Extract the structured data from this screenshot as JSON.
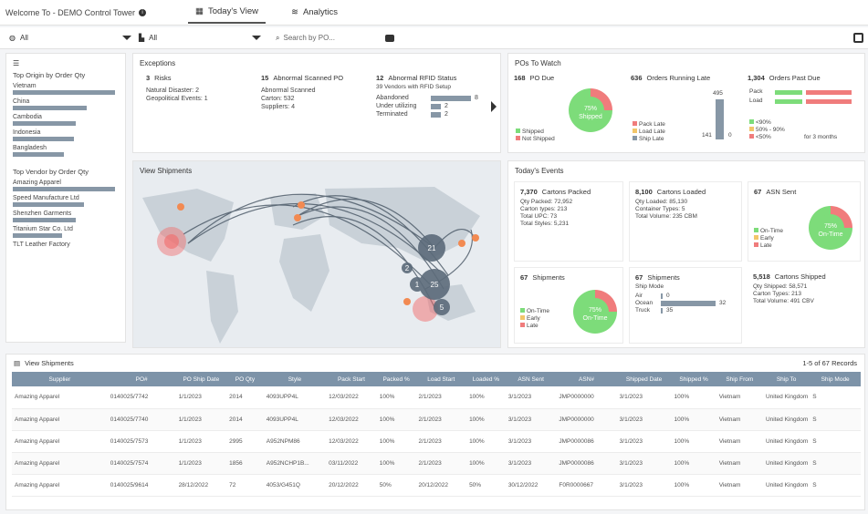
{
  "topbar": {
    "title": "Welcome To - DEMO Control Tower",
    "tab_today": "Today's View",
    "tab_analytics": "Analytics"
  },
  "filters": {
    "filter1": "All",
    "filter2": "All",
    "search_placeholder": "Search by PO..."
  },
  "left": {
    "origin_title": "Top Origin by Order Qty",
    "origins": [
      {
        "name": "Vietnam",
        "value": 100
      },
      {
        "name": "China",
        "value": 72
      },
      {
        "name": "Cambodia",
        "value": 62
      },
      {
        "name": "Indonesia",
        "value": 60
      },
      {
        "name": "Bangladesh",
        "value": 50
      }
    ],
    "vendor_title": "Top Vendor by Order Qty",
    "vendors": [
      {
        "name": "Amazing Apparel",
        "value": 100
      },
      {
        "name": "Speed Manufacture Ltd",
        "value": 70
      },
      {
        "name": "Shenzhen Garments",
        "value": 62
      },
      {
        "name": "Titanium Star Co. Ltd",
        "value": 48
      },
      {
        "name": "TLT Leather Factory",
        "value": 0
      }
    ]
  },
  "exceptions": {
    "title": "Exceptions",
    "risks": {
      "count": "3",
      "label": "Risks",
      "lines": [
        "Natural Disaster: 2",
        "Geopolitical Events: 1"
      ]
    },
    "scanned": {
      "count": "15",
      "label": "Abnormal Scanned PO",
      "lines": [
        "Abnormal Scanned",
        "Carton: 532",
        "Suppliers: 4"
      ]
    },
    "rfid": {
      "count": "12",
      "label": "Abnormal RFID Status",
      "sub": "39 Vendors with RFID Setup",
      "rows": [
        {
          "label": "Abandoned",
          "value": "8",
          "fill": 1.0
        },
        {
          "label": "Under utilizing",
          "value": "2",
          "fill": 0.25
        },
        {
          "label": "Terminated",
          "value": "2",
          "fill": 0.25
        }
      ]
    }
  },
  "map": {
    "title": "View Shipments",
    "clusters": [
      "21",
      "2",
      "1",
      "25",
      "5"
    ]
  },
  "pos": {
    "title": "POs To Watch",
    "due": {
      "count": "168",
      "label": "PO Due",
      "pct": "75%",
      "center": "Shipped",
      "shipped_share": 0.75,
      "legend": [
        "Shipped",
        "Not Shipped"
      ]
    },
    "late": {
      "count": "636",
      "label": "Orders Running Late",
      "pct": "495",
      "legend": [
        "Pack Late",
        "Load Late",
        "Ship Late"
      ],
      "val": "141",
      "zero": "0"
    },
    "past": {
      "count": "1,304",
      "label": "Orders Past Due",
      "rows": [
        "Pack",
        "Load"
      ],
      "legend": [
        "<90%",
        "50% - 90%",
        "<50%"
      ],
      "note": "for 3 months"
    }
  },
  "events": {
    "title": "Today's Events",
    "packed": {
      "count": "7,370",
      "label": "Cartons Packed",
      "lines": [
        "Qty Packed: 72,952",
        "Carton types: 213",
        "Total UPC: 73",
        "Total Styles: 5,231"
      ]
    },
    "loaded": {
      "count": "8,100",
      "label": "Cartons Loaded",
      "lines": [
        "Qty Loaded: 85,130",
        "Container Types: 5",
        "Total Volume: 235 CBM"
      ]
    },
    "asn": {
      "count": "67",
      "label": "ASN Sent",
      "pct": "75%",
      "center": "On-Time",
      "on_time_share": 0.75,
      "legend": [
        "On-Time",
        "Early",
        "Late"
      ]
    },
    "shipments": {
      "count": "67",
      "label": "Shipments",
      "pct": "75%",
      "center": "On-Time",
      "on_time_share": 0.75,
      "legend": [
        "On-Time",
        "Early",
        "Late"
      ]
    },
    "mode": {
      "count": "67",
      "label": "Shipments",
      "sub": "Ship Mode",
      "rows": [
        {
          "label": "Air",
          "value": "0",
          "fill": 0.0
        },
        {
          "label": "Ocean",
          "value": "32",
          "fill": 1.0
        },
        {
          "label": "Truck",
          "value": "35",
          "fill": 0.0
        }
      ]
    },
    "shipped": {
      "count": "5,518",
      "label": "Cartons Shipped",
      "lines": [
        "Qty Shipped: 58,571",
        "Carton Types: 213",
        "Total Volume: 491 CBV"
      ]
    }
  },
  "table": {
    "title": "View Shipments",
    "records": "1-5 of 67 Records",
    "columns": [
      "Supplier",
      "PO#",
      "PO Ship Date",
      "PO Qty",
      "Style",
      "Pack Start",
      "Packed %",
      "Load Start",
      "Loaded %",
      "ASN Sent",
      "ASN#",
      "Shipped Date",
      "Shipped %",
      "Ship From",
      "Ship To",
      "Ship Mode"
    ],
    "rows": [
      [
        "Amazing Apparel",
        "0140025/7742",
        "1/1/2023",
        "2014",
        "4093UPP4L",
        "12/03/2022",
        "100%",
        "2/1/2023",
        "100%",
        "3/1/2023",
        "JMP0000000",
        "3/1/2023",
        "100%",
        "Vietnam",
        "United Kingdom",
        "S"
      ],
      [
        "Amazing Apparel",
        "0140025/7740",
        "1/1/2023",
        "2014",
        "4093UPP4L",
        "12/03/2022",
        "100%",
        "2/1/2023",
        "100%",
        "3/1/2023",
        "JMP0000000",
        "3/1/2023",
        "100%",
        "Vietnam",
        "United Kingdom",
        "S"
      ],
      [
        "Amazing Apparel",
        "0140025/7573",
        "1/1/2023",
        "2995",
        "A952NPM86",
        "12/03/2022",
        "100%",
        "2/1/2023",
        "100%",
        "3/1/2023",
        "JMP0000086",
        "3/1/2023",
        "100%",
        "Vietnam",
        "United Kingdom",
        "S"
      ],
      [
        "Amazing Apparel",
        "0140025/7574",
        "1/1/2023",
        "1856",
        "A952NCHP1B...",
        "03/11/2022",
        "100%",
        "2/1/2023",
        "100%",
        "3/1/2023",
        "JMP0000086",
        "3/1/2023",
        "100%",
        "Vietnam",
        "United Kingdom",
        "S"
      ],
      [
        "Amazing Apparel",
        "0140025/9614",
        "28/12/2022",
        "72",
        "4053/G451Q",
        "20/12/2022",
        "50%",
        "20/12/2022",
        "50%",
        "30/12/2022",
        "F0R0000667",
        "3/1/2023",
        "100%",
        "Vietnam",
        "United Kingdom",
        "S"
      ]
    ]
  },
  "colors": {
    "accent_bar": "#8797a6",
    "donut_green": "#7ddc7a",
    "donut_red": "#f07c7c",
    "header_blue": "#7d93a8"
  }
}
